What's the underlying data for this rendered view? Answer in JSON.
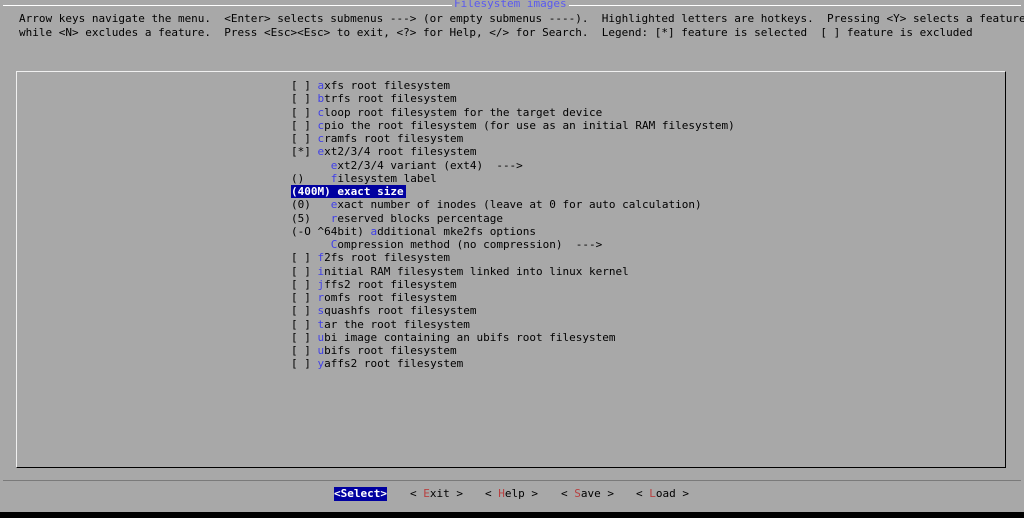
{
  "window": {
    "title": "Filesystem images"
  },
  "help_text": {
    "line1": "Arrow keys navigate the menu.  <Enter> selects submenus ---> (or empty submenus ----).  Highlighted letters are hotkeys.  Pressing <Y> selects a feature,",
    "line2": "while <N> excludes a feature.  Press <Esc><Esc> to exit, <?> for Help, </> for Search.  Legend: [*] feature is selected  [ ] feature is excluded"
  },
  "menu": {
    "items": [
      {
        "prefix": "[ ] ",
        "hotkey": "a",
        "rest": "xfs root filesystem"
      },
      {
        "prefix": "[ ] ",
        "hotkey": "b",
        "rest": "trfs root filesystem"
      },
      {
        "prefix": "[ ] ",
        "hotkey": "c",
        "rest": "loop root filesystem for the target device"
      },
      {
        "prefix": "[ ] ",
        "hotkey": "c",
        "rest": "pio the root filesystem (for use as an initial RAM filesystem)"
      },
      {
        "prefix": "[ ] ",
        "hotkey": "c",
        "rest": "ramfs root filesystem"
      },
      {
        "prefix": "[*] ",
        "hotkey": "e",
        "rest": "xt2/3/4 root filesystem"
      },
      {
        "prefix": "      ",
        "hotkey": "e",
        "rest": "xt2/3/4 variant (ext4)  --->"
      },
      {
        "prefix": "()    ",
        "hotkey": "f",
        "rest": "ilesystem label"
      },
      {
        "prefix": "(",
        "hotkey": "4",
        "rest": "00M) exact size"
      },
      {
        "prefix": "(0)   ",
        "hotkey": "e",
        "rest": "xact number of inodes (leave at 0 for auto calculation)"
      },
      {
        "prefix": "(5)   ",
        "hotkey": "r",
        "rest": "eserved blocks percentage"
      },
      {
        "prefix": "(-O ^64bit) ",
        "hotkey": "a",
        "rest": "dditional mke2fs options"
      },
      {
        "prefix": "      ",
        "hotkey": "C",
        "rest": "ompression method (no compression)  --->"
      },
      {
        "prefix": "[ ] ",
        "hotkey": "f",
        "rest": "2fs root filesystem"
      },
      {
        "prefix": "[ ] ",
        "hotkey": "i",
        "rest": "nitial RAM filesystem linked into linux kernel"
      },
      {
        "prefix": "[ ] ",
        "hotkey": "j",
        "rest": "ffs2 root filesystem"
      },
      {
        "prefix": "[ ] ",
        "hotkey": "r",
        "rest": "omfs root filesystem"
      },
      {
        "prefix": "[ ] ",
        "hotkey": "s",
        "rest": "quashfs root filesystem"
      },
      {
        "prefix": "[ ] ",
        "hotkey": "t",
        "rest": "ar the root filesystem"
      },
      {
        "prefix": "[ ] ",
        "hotkey": "u",
        "rest": "bi image containing an ubifs root filesystem"
      },
      {
        "prefix": "[ ] ",
        "hotkey": "u",
        "rest": "bifs root filesystem"
      },
      {
        "prefix": "[ ] ",
        "hotkey": "y",
        "rest": "affs2 root filesystem"
      }
    ],
    "selected_index": 8
  },
  "buttons": [
    {
      "open": "<",
      "hotkey": "S",
      "rest": "elect",
      "close": ">",
      "active": true
    },
    {
      "open": "< ",
      "hotkey": "E",
      "rest": "xit",
      "close": " >",
      "active": false
    },
    {
      "open": "< ",
      "hotkey": "H",
      "rest": "elp",
      "close": " >",
      "active": false
    },
    {
      "open": "< ",
      "hotkey": "S",
      "rest": "ave",
      "close": " >",
      "active": false
    },
    {
      "open": "< ",
      "hotkey": "L",
      "rest": "oad",
      "close": " >",
      "active": false
    }
  ]
}
